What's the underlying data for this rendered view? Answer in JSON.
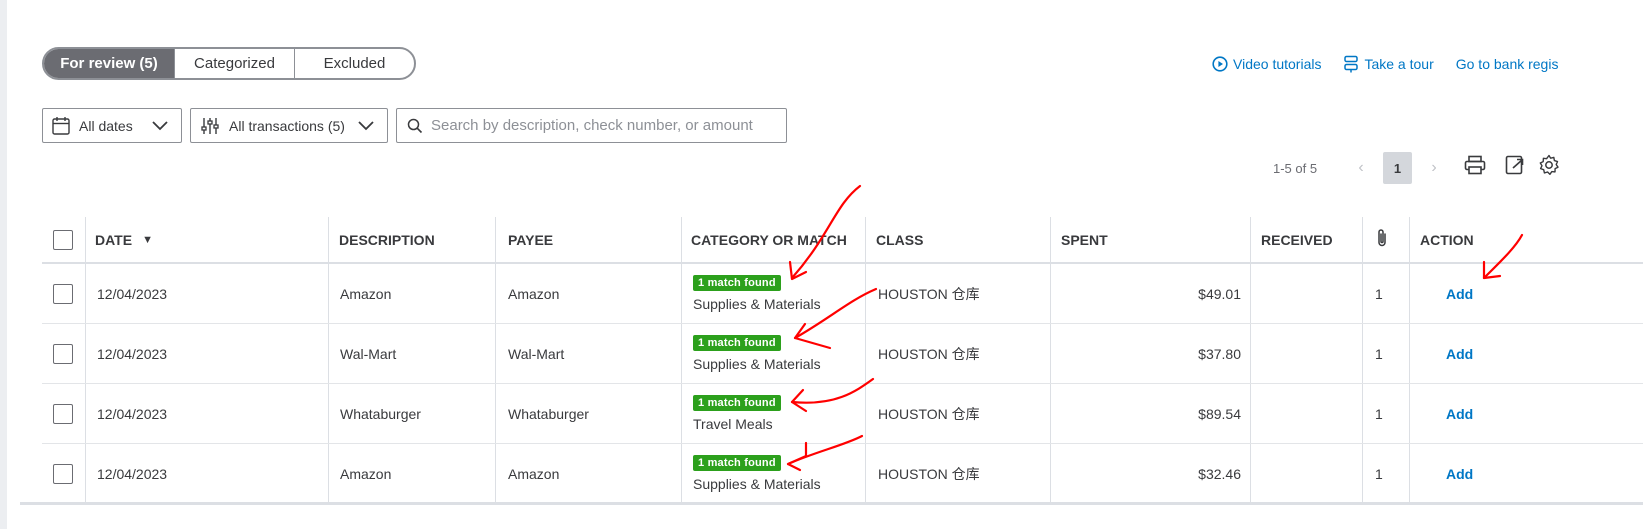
{
  "tabs": [
    {
      "label": "For review (5)",
      "active": true
    },
    {
      "label": "Categorized",
      "active": false
    },
    {
      "label": "Excluded",
      "active": false
    }
  ],
  "links": {
    "video_tutorials": "Video tutorials",
    "take_tour": "Take a tour",
    "bank_register": "Go to bank regis"
  },
  "filters": {
    "dates": "All dates",
    "transactions": "All transactions (5)",
    "search_placeholder": "Search by description, check number, or amount"
  },
  "pager": {
    "range": "1-5 of 5",
    "prev": "‹",
    "current": "1",
    "next": "›"
  },
  "table": {
    "headers": {
      "date": "DATE",
      "sort_arrow": "▼",
      "description": "DESCRIPTION",
      "payee": "PAYEE",
      "category": "CATEGORY OR MATCH",
      "class": "CLASS",
      "spent": "SPENT",
      "received": "RECEIVED",
      "action": "ACTION"
    },
    "rows": [
      {
        "date": "12/04/2023",
        "description": "Amazon",
        "payee": "Amazon",
        "badge": "1 match found",
        "category": "Supplies & Materials",
        "class": "HOUSTON 仓库",
        "spent": "$49.01",
        "received": "",
        "attachments": "1",
        "action": "Add"
      },
      {
        "date": "12/04/2023",
        "description": "Wal-Mart",
        "payee": "Wal-Mart",
        "badge": "1 match found",
        "category": "Supplies & Materials",
        "class": "HOUSTON 仓库",
        "spent": "$37.80",
        "received": "",
        "attachments": "1",
        "action": "Add"
      },
      {
        "date": "12/04/2023",
        "description": "Whataburger",
        "payee": "Whataburger",
        "badge": "1 match found",
        "category": "Travel Meals",
        "class": "HOUSTON 仓库",
        "spent": "$89.54",
        "received": "",
        "attachments": "1",
        "action": "Add"
      },
      {
        "date": "12/04/2023",
        "description": "Amazon",
        "payee": "Amazon",
        "badge": "1 match found",
        "category": "Supplies & Materials",
        "class": "HOUSTON 仓库",
        "spent": "$32.46",
        "received": "",
        "attachments": "1",
        "action": "Add"
      }
    ]
  },
  "colors": {
    "link": "#0077c5",
    "badge": "#2ca01c",
    "active_tab": "#6b6c72",
    "annotation": "#ff0000"
  }
}
